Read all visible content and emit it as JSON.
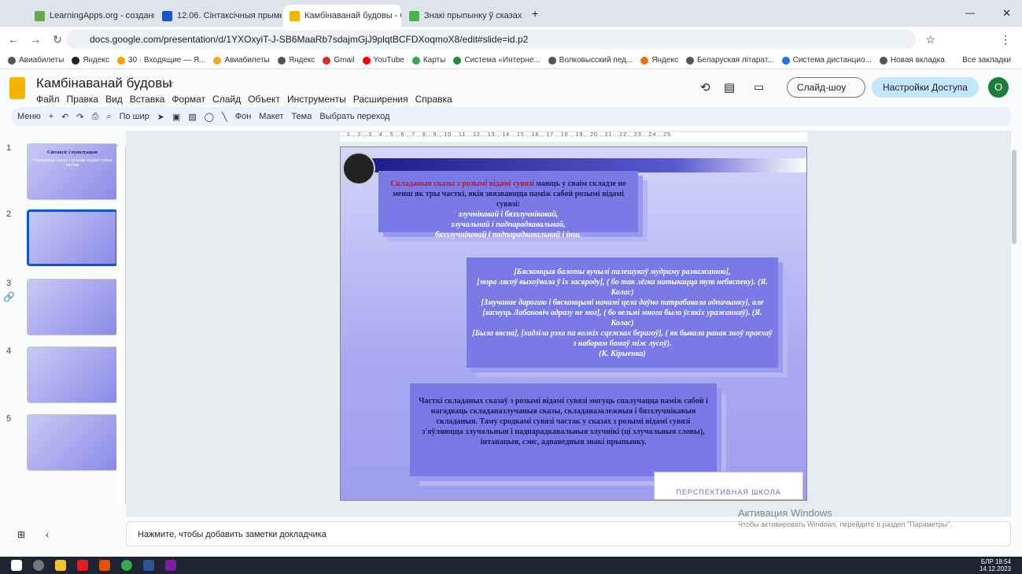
{
  "browser": {
    "tabs": [
      {
        "label": "LearningApps.org - создание ..."
      },
      {
        "label": "12.06. Сінтаксічныя прыметы..."
      },
      {
        "label": "Камбінаванай будовы - Goo..."
      },
      {
        "label": "Знакі прыпынку ў сказах з пр..."
      }
    ],
    "url": "docs.google.com/presentation/d/1YXOxyiT-J-SB6MaaRb7sdajmGjJ9plqtBCFDXoqmoX8/edit#slide=id.p2",
    "bookmarks": [
      "Авиабилеты",
      "Яндекс",
      "30 · Входящие — Я...",
      "Авиабилеты",
      "Яндекс",
      "Gmail",
      "YouTube",
      "Карты",
      "Система «Интерне...",
      "Волковысский пед...",
      "Яндекс",
      "Беларуская літарат...",
      "Система дистанцио...",
      "Новая вкладка"
    ],
    "all_bookmarks": "Все закладки"
  },
  "doc": {
    "title": "Камбінаванай будовы",
    "menu": [
      "Файл",
      "Правка",
      "Вид",
      "Вставка",
      "Формат",
      "Слайд",
      "Объект",
      "Инструменты",
      "Расширения",
      "Справка"
    ],
    "slideshow": "Слайд-шоу",
    "share": "Настройки Доступа",
    "avatar": "О"
  },
  "toolbar": {
    "menu": "Меню",
    "zoom": "По шир",
    "bg": "Фон",
    "layout": "Макет",
    "theme": "Тема",
    "transition": "Выбрать переход"
  },
  "ruler_ticks": [
    "1",
    "2",
    "3",
    "4",
    "5",
    "6",
    "7",
    "8",
    "9",
    "10",
    "11",
    "12",
    "13",
    "14",
    "15",
    "16",
    "17",
    "18",
    "19",
    "20",
    "21",
    "22",
    "23",
    "24",
    "25"
  ],
  "thumbs": [
    {
      "num": "1",
      "title": "Сінтаксіс і пунктуацыя",
      "sub": "Складаныя сказы з розымі відамі сувязі частак"
    },
    {
      "num": "2"
    },
    {
      "num": "3"
    },
    {
      "num": "4"
    },
    {
      "num": "5"
    }
  ],
  "slide": {
    "box1": {
      "red": "Складаныя сказы з розымі відамі сувязі",
      "rest": "маюць у сваім складзе не менш як тры часткі, якія звязваюцца паміж сабой розымі відамі сувязі:",
      "l1": "злучнікавай і бяззлучнікавай,",
      "l2": "злучальнай і падпарадкавальнай,",
      "l3": "бяззлучнікавай і падпарадкавальнай і інш."
    },
    "box2": {
      "l1": "[Бясконцыя балоты вучылі палешукоў мудраму разважанню],",
      "l2": "[мора лясоў выхоўвала ў іх засяроду], ( бо так лёгка натыкацца тут небяспеку). (Я. Колас)",
      "l3": "[Змучанае дарогаю і бясконцымі начамі цела даўно патрабавала адпачынку], але [заснуць Лабановіч адразу не мог], ( бо вельмі многа было ўсякіх уражанняў). (Я. Колас)",
      "l4": "[Была вясна], [хадзіла рэха па волкіх сцежках берагоў], ( як бывала ранак зноў праехаў з наборам бомаў між лусоў).",
      "l5": "(К. Кірыенка)"
    },
    "box3": "Часткі складаных сказаў з розымі відамі сувязі могуць спалучацца паміж сабой і нагадваць складаназлучаныя сказы, складаназалежныя і бяззлучнікавыя складаныя. Таму сродкамі сувязі частак у сказах з розымі відамі сувязі з'яўляюцца злучальныя і падпарадкавальныя злучнікі (ці злучальныя словы), інтанацыя, сэнс, адпаведныя знакі прыпынку.",
    "logo": "ПЕРСПЕКТИВНАЯ ШКОЛА"
  },
  "notes": "Нажмите, чтобы добавить заметки докладчика",
  "activation": {
    "title": "Активация Windows",
    "sub": "Чтобы активировать Windows, перейдите в раздел \"Параметры\"."
  },
  "tray": {
    "lang": "БЛР",
    "time": "18:54",
    "date": "14.12.2023"
  }
}
